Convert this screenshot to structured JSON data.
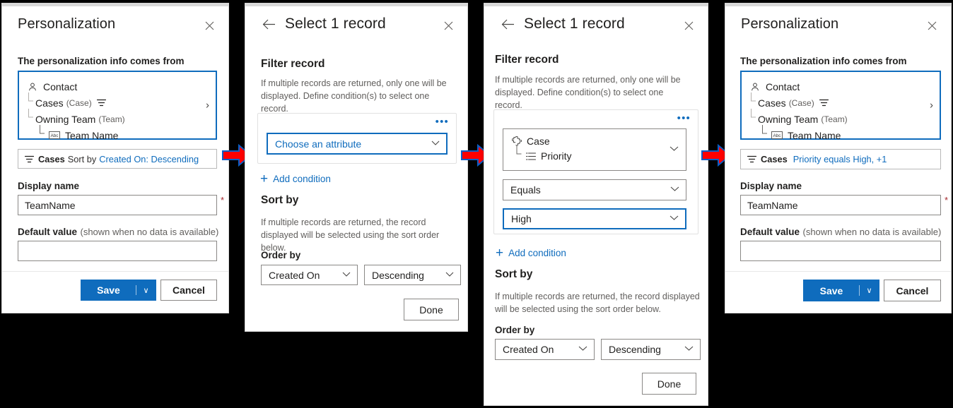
{
  "colors": {
    "accent": "#0f6cbd",
    "arrow_fill": "#ff0000",
    "arrow_stroke": "#0a5ec7",
    "required": "#a4262c",
    "canvas": "#000000"
  },
  "panel1": {
    "title": "Personalization",
    "close_label": "Close",
    "source_label": "The personalization info comes from",
    "tree": [
      {
        "label": "Contact",
        "type": "",
        "icon": "contact-icon",
        "depth": 0,
        "has_filter": false
      },
      {
        "label": "Cases",
        "type": "(Case)",
        "icon": "",
        "depth": 1,
        "has_filter": true
      },
      {
        "label": "Owning Team",
        "type": "(Team)",
        "icon": "",
        "depth": 1,
        "has_filter": false
      },
      {
        "label": "Team Name",
        "type": "",
        "icon": "abc-icon",
        "depth": 2,
        "has_filter": false
      }
    ],
    "expand_chevron": "›",
    "summary": {
      "entity": "Cases",
      "middle": "Sort by",
      "value": "Created On: Descending"
    },
    "display_name_label": "Display name",
    "display_name_value": "TeamName",
    "required_mark": "*",
    "default_value_label": "Default value",
    "default_value_hint": "(shown when no data is available)",
    "default_value_value": "",
    "save_label": "Save",
    "save_carat": "∨",
    "cancel_label": "Cancel"
  },
  "panel2": {
    "back_label": "Back",
    "title": "Select 1 record",
    "close_label": "Close",
    "filter_heading": "Filter record",
    "filter_desc": "If multiple records are returned, only one will be displayed. Define condition(s) to select one record.",
    "card_menu": "•••",
    "attribute_value": "Choose an attribute",
    "add_condition": "Add condition",
    "add_condition_plus": "+",
    "sort_heading": "Sort by",
    "sort_desc": "If multiple records are returned, the record displayed will be selected using the sort order below.",
    "order_by_label": "Order by",
    "order_field": "Created On",
    "order_dir": "Descending",
    "done_label": "Done"
  },
  "panel3": {
    "back_label": "Back",
    "title": "Select 1 record",
    "close_label": "Close",
    "filter_heading": "Filter record",
    "filter_desc": "If multiple records are returned, only one will be displayed. Define condition(s) to select one record.",
    "card_menu": "•••",
    "attribute_entity": "Case",
    "attribute_field": "Priority",
    "operator_value": "Equals",
    "operand_value": "High",
    "add_condition": "Add condition",
    "add_condition_plus": "+",
    "sort_heading": "Sort by",
    "sort_desc": "If multiple records are returned, the record displayed will be selected using the sort order below.",
    "order_by_label": "Order by",
    "order_field": "Created On",
    "order_dir": "Descending",
    "done_label": "Done"
  },
  "panel4": {
    "title": "Personalization",
    "close_label": "Close",
    "source_label": "The personalization info comes from",
    "tree": [
      {
        "label": "Contact",
        "type": "",
        "icon": "contact-icon",
        "depth": 0,
        "has_filter": false
      },
      {
        "label": "Cases",
        "type": "(Case)",
        "icon": "",
        "depth": 1,
        "has_filter": true
      },
      {
        "label": "Owning Team",
        "type": "(Team)",
        "icon": "",
        "depth": 1,
        "has_filter": false
      },
      {
        "label": "Team Name",
        "type": "",
        "icon": "abc-icon",
        "depth": 2,
        "has_filter": false
      }
    ],
    "expand_chevron": "›",
    "summary": {
      "entity": "Cases",
      "middle": "",
      "value": "Priority equals High, +1"
    },
    "display_name_label": "Display name",
    "display_name_value": "TeamName",
    "required_mark": "*",
    "default_value_label": "Default value",
    "default_value_hint": "(shown when no data is available)",
    "default_value_value": "",
    "save_label": "Save",
    "save_carat": "∨",
    "cancel_label": "Cancel"
  }
}
